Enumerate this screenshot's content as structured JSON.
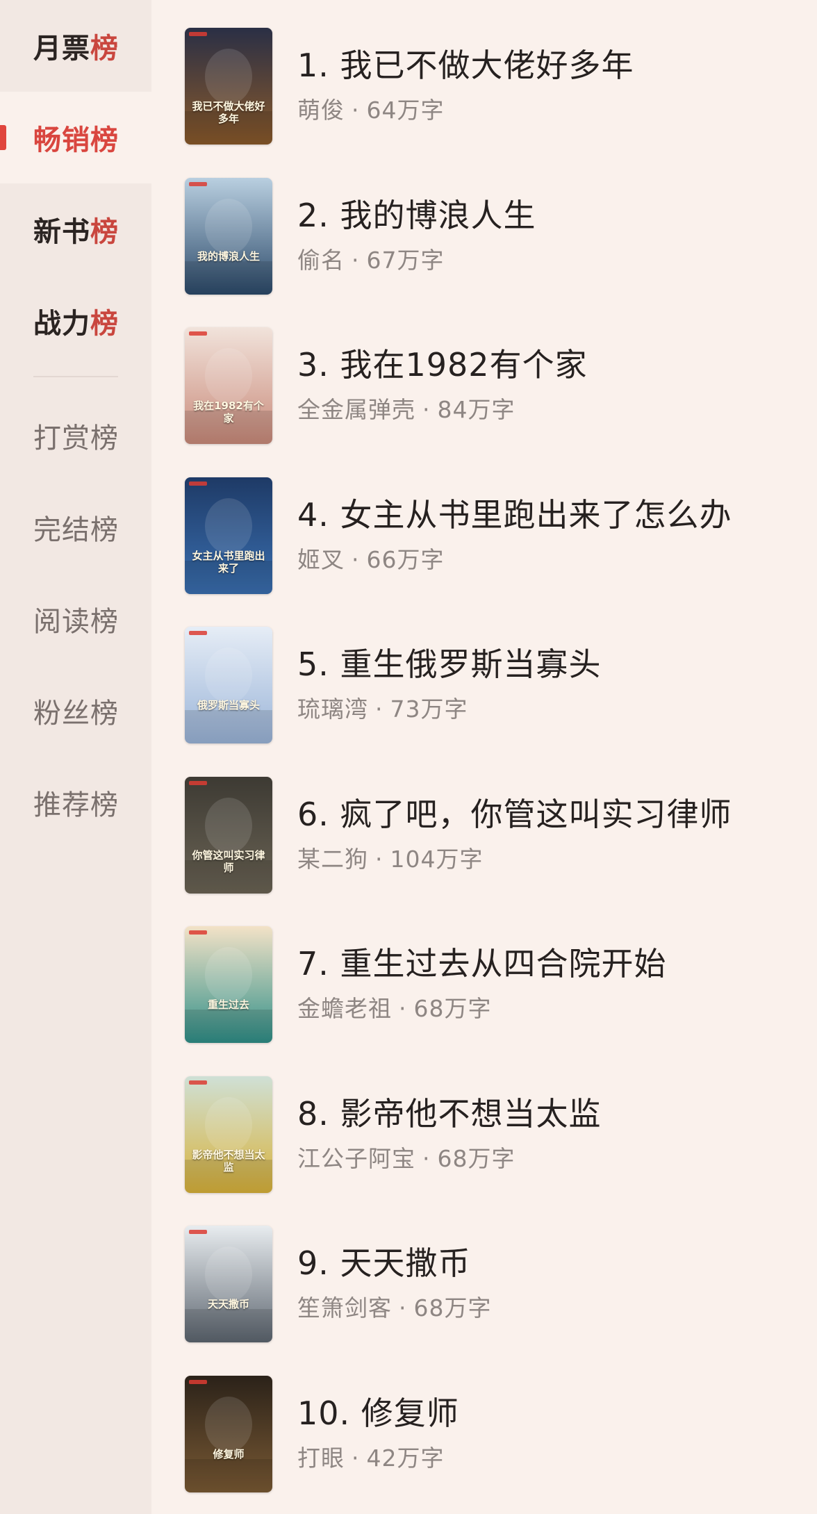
{
  "sidebar": {
    "items": [
      {
        "prefix": "月票",
        "accent": "榜",
        "kind": "primary"
      },
      {
        "prefix": "畅销",
        "accent": "榜",
        "kind": "primary"
      },
      {
        "prefix": "新书",
        "accent": "榜",
        "kind": "primary"
      },
      {
        "prefix": "战力",
        "accent": "榜",
        "kind": "primary"
      },
      {
        "prefix": "打赏榜",
        "accent": "",
        "kind": "secondary"
      },
      {
        "prefix": "完结榜",
        "accent": "",
        "kind": "secondary"
      },
      {
        "prefix": "阅读榜",
        "accent": "",
        "kind": "secondary"
      },
      {
        "prefix": "粉丝榜",
        "accent": "",
        "kind": "secondary"
      },
      {
        "prefix": "推荐榜",
        "accent": "",
        "kind": "secondary"
      }
    ],
    "active_index": 1
  },
  "books": [
    {
      "title": "1. 我已不做大佬好多年",
      "author": "萌俊",
      "words": "64万字",
      "cover_text": "我已不做大佬好多年",
      "cover_colors": [
        "#2a2f45",
        "#8a5a2b"
      ]
    },
    {
      "title": "2. 我的博浪人生",
      "author": "偷名",
      "words": "67万字",
      "cover_text": "我的博浪人生",
      "cover_colors": [
        "#b9cfe0",
        "#2c4a6a"
      ]
    },
    {
      "title": "3. 我在1982有个家",
      "author": "全金属弹壳",
      "words": "84万字",
      "cover_text": "我在1982有个家",
      "cover_colors": [
        "#f1e3db",
        "#c98a7a"
      ]
    },
    {
      "title": "4. 女主从书里跑出来了怎么办",
      "author": "姬叉",
      "words": "66万字",
      "cover_text": "女主从书里跑出来了",
      "cover_colors": [
        "#1e3a66",
        "#3a6fb0"
      ]
    },
    {
      "title": "5. 重生俄罗斯当寡头",
      "author": "琉璃湾",
      "words": "73万字",
      "cover_text": "俄罗斯当寡头",
      "cover_colors": [
        "#e6edf6",
        "#9ab4d8"
      ]
    },
    {
      "title": "6. 疯了吧，你管这叫实习律师",
      "author": "某二狗",
      "words": "104万字",
      "cover_text": "你管这叫实习律师",
      "cover_colors": [
        "#3d3a33",
        "#6b6455"
      ]
    },
    {
      "title": "7. 重生过去从四合院开始",
      "author": "金蟾老祖",
      "words": "68万字",
      "cover_text": "重生过去",
      "cover_colors": [
        "#f3e2c7",
        "#2f8f88"
      ]
    },
    {
      "title": "8. 影帝他不想当太监",
      "author": "江公子阿宝",
      "words": "68万字",
      "cover_text": "影帝他不想当太监",
      "cover_colors": [
        "#cfe0d6",
        "#d9b23a"
      ]
    },
    {
      "title": "9. 天天撒币",
      "author": "笙箫剑客",
      "words": "68万字",
      "cover_text": "天天撒币",
      "cover_colors": [
        "#e8ecef",
        "#5d6670"
      ]
    },
    {
      "title": "10. 修复师",
      "author": "打眼",
      "words": "42万字",
      "cover_text": "修复师",
      "cover_colors": [
        "#2b2219",
        "#7a5a34"
      ]
    }
  ],
  "meta_separator": "·"
}
